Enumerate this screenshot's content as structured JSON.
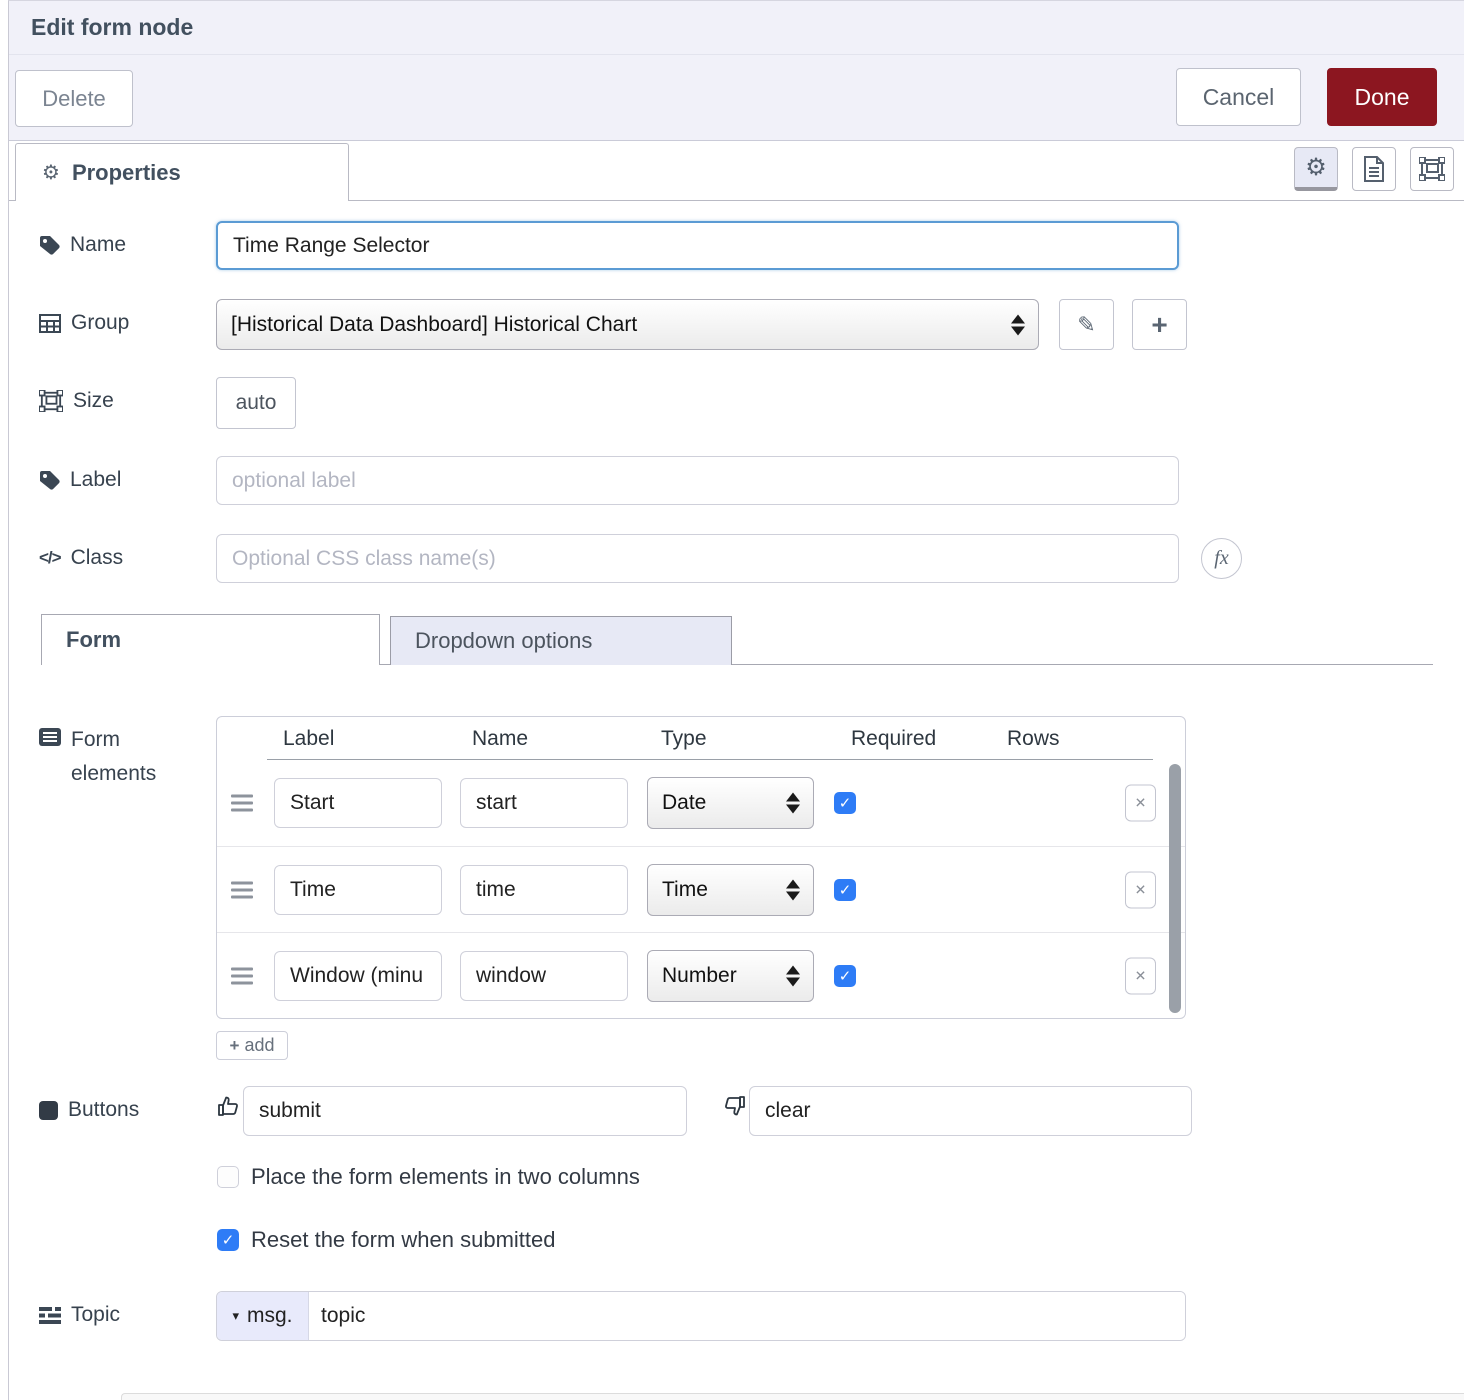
{
  "colors": {
    "accent_red": "#8c1620",
    "focus_blue": "#5b9bd4",
    "checkbox_blue": "#2e7cf6",
    "header_bg": "#f1f1f9",
    "inactive_tab_bg": "#e7e9f5"
  },
  "icons": {
    "gear": "⚙",
    "pencil": "✎",
    "plus": "+",
    "close": "✕",
    "check": "✓",
    "caret_down": "▾",
    "fx": "fx",
    "class_glyph": "</>"
  },
  "dialog": {
    "title": "Edit form node"
  },
  "header_buttons": {
    "delete": "Delete",
    "cancel": "Cancel",
    "done": "Done"
  },
  "properties_tab": {
    "label": "Properties"
  },
  "fields": {
    "name": {
      "label": "Name",
      "value": "Time Range Selector"
    },
    "group": {
      "label": "Group",
      "value": "[Historical Data Dashboard] Historical Chart"
    },
    "size": {
      "label": "Size",
      "value": "auto"
    },
    "label": {
      "label": "Label",
      "value": "",
      "placeholder": "optional label"
    },
    "class": {
      "label": "Class",
      "value": "",
      "placeholder": "Optional CSS class name(s)"
    }
  },
  "section_tabs": {
    "form": "Form",
    "dropdown": "Dropdown options"
  },
  "form_elements": {
    "label": "Form elements",
    "columns": [
      "Label",
      "Name",
      "Type",
      "Required",
      "Rows"
    ],
    "rows": [
      {
        "label": "Start",
        "name": "start",
        "type": "Date",
        "required": true
      },
      {
        "label": "Time",
        "name": "time",
        "type": "Time",
        "required": true
      },
      {
        "label": "Window (minu",
        "name": "window",
        "type": "Number",
        "required": true
      }
    ],
    "add_label": "add"
  },
  "buttons_section": {
    "label": "Buttons",
    "submit_value": "submit",
    "clear_value": "clear"
  },
  "options": [
    {
      "label": "Place the form elements in two columns",
      "checked": false
    },
    {
      "label": "Reset the form when submitted",
      "checked": true
    }
  ],
  "topic": {
    "label": "Topic",
    "prefix": "msg.",
    "value": "topic"
  }
}
